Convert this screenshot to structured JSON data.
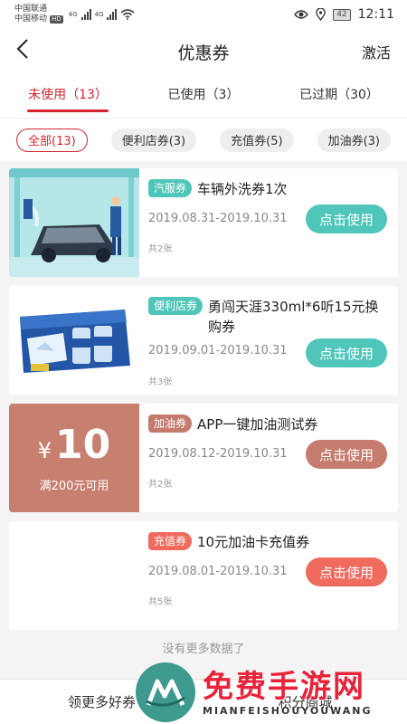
{
  "statusbar": {
    "carrier1": "中国联通",
    "carrier2": "中国移动",
    "hd": "HD",
    "net1": "4G",
    "net2": "4G",
    "battery": "42",
    "time": "12:11"
  },
  "navbar": {
    "title": "优惠券",
    "action": "激活"
  },
  "tabs": [
    {
      "label": "未使用（13）",
      "active": true
    },
    {
      "label": "已使用（3）",
      "active": false
    },
    {
      "label": "已过期（30）",
      "active": false
    }
  ],
  "filters": [
    {
      "label": "全部(13)",
      "active": true
    },
    {
      "label": "便利店券(3)",
      "active": false
    },
    {
      "label": "充值券(5)",
      "active": false
    },
    {
      "label": "加油券(3)",
      "active": false
    }
  ],
  "coupons": [
    {
      "tag": "汽服券",
      "tag_color": "#4fc6b9",
      "title": "车辆外洗券1次",
      "date": "2019.08.31-2019.10.31",
      "count": "共2张",
      "button": "点击使用",
      "button_color": "#4fc6b9"
    },
    {
      "tag": "便利店券",
      "tag_color": "#4fc6b9",
      "title": "勇闯天涯330ml*6听15元换购券",
      "date": "2019.09.01-2019.10.31",
      "count": "共3张",
      "button": "点击使用",
      "button_color": "#4fc6b9"
    },
    {
      "tag": "加油券",
      "tag_color": "#c57b6e",
      "title": "APP一键加油测试券",
      "date": "2019.08.12-2019.10.31",
      "count": "共2张",
      "button": "点击使用",
      "button_color": "#c57b6e",
      "face_currency": "¥",
      "face_value": "10",
      "face_condition": "满200元可用"
    },
    {
      "tag": "充值券",
      "tag_color": "#ee6b5e",
      "title": "10元加油卡充值券",
      "date": "2019.08.01-2019.10.31",
      "count": "共5张",
      "button": "点击使用",
      "button_color": "#ee6b5e"
    }
  ],
  "no_more": "没有更多数据了",
  "bottom": {
    "left": "领更多好券",
    "right": "积分商城"
  },
  "watermark": {
    "big": "免费手游网",
    "small": "MIANFEISHOUYOUWANG"
  },
  "colors": {
    "accent": "#d3242f",
    "teal": "#4fc6b9"
  }
}
